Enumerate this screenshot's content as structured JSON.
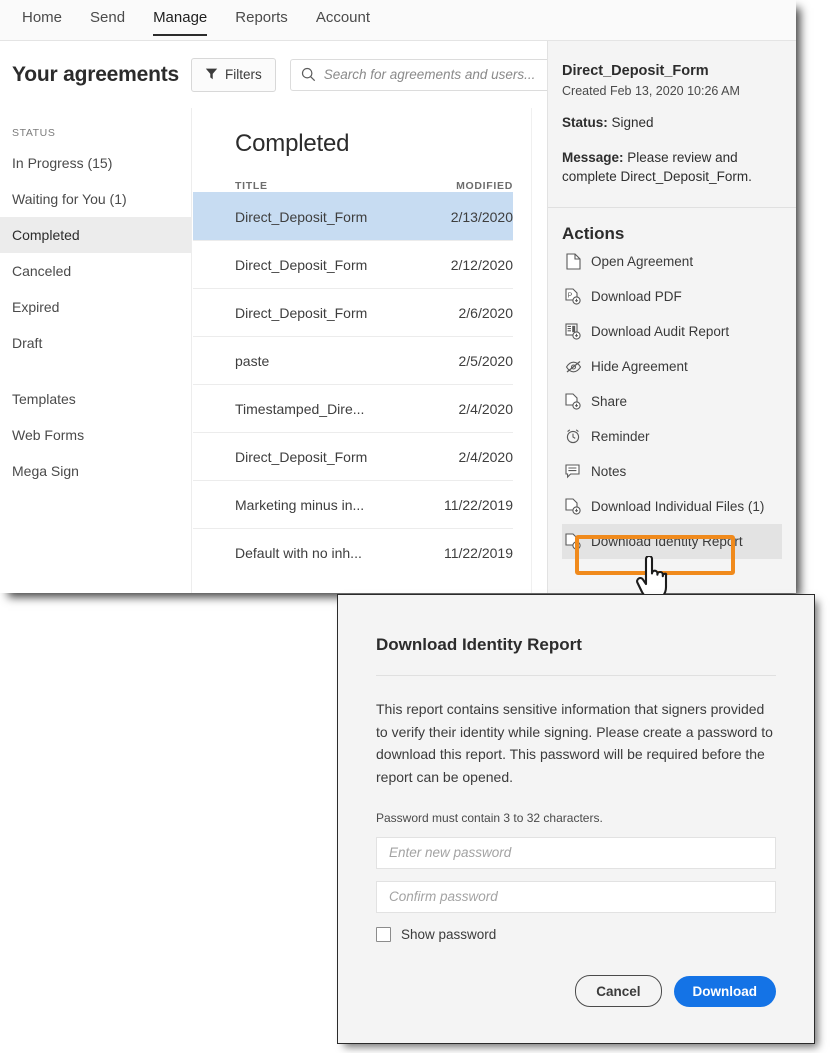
{
  "colors": {
    "accent_blue": "#1473E6",
    "callout_orange": "#F08A1C",
    "selected_row_blue": "#C7DCF2",
    "panel_gray": "#F4F4F4"
  },
  "top_nav": {
    "tabs": [
      {
        "label": "Home",
        "active": false
      },
      {
        "label": "Send",
        "active": false
      },
      {
        "label": "Manage",
        "active": true
      },
      {
        "label": "Reports",
        "active": false
      },
      {
        "label": "Account",
        "active": false
      }
    ]
  },
  "header": {
    "title": "Your agreements",
    "filters_label": "Filters",
    "filter_icon": "funnel-icon",
    "search": {
      "icon": "search-icon",
      "placeholder": "Search for agreements and users...",
      "value": ""
    }
  },
  "sidebar": {
    "section_label": "STATUS",
    "items": [
      {
        "label": "In Progress (15)",
        "selected": false
      },
      {
        "label": "Waiting for You (1)",
        "selected": false
      },
      {
        "label": "Completed",
        "selected": true
      },
      {
        "label": "Canceled",
        "selected": false
      },
      {
        "label": "Expired",
        "selected": false
      },
      {
        "label": "Draft",
        "selected": false
      }
    ],
    "secondary_items": [
      {
        "label": "Templates"
      },
      {
        "label": "Web Forms"
      },
      {
        "label": "Mega Sign"
      }
    ]
  },
  "list": {
    "title": "Completed",
    "columns": {
      "title": "TITLE",
      "modified": "MODIFIED"
    },
    "rows": [
      {
        "title": "Direct_Deposit_Form",
        "modified": "2/13/2020",
        "selected": true
      },
      {
        "title": "Direct_Deposit_Form",
        "modified": "2/12/2020",
        "selected": false
      },
      {
        "title": "Direct_Deposit_Form",
        "modified": "2/6/2020",
        "selected": false
      },
      {
        "title": "paste",
        "modified": "2/5/2020",
        "selected": false
      },
      {
        "title": "Timestamped_Dire...",
        "modified": "2/4/2020",
        "selected": false
      },
      {
        "title": "Direct_Deposit_Form",
        "modified": "2/4/2020",
        "selected": false
      },
      {
        "title": "Marketing minus in...",
        "modified": "11/22/2019",
        "selected": false
      },
      {
        "title": "Default with no inh...",
        "modified": "11/22/2019",
        "selected": false
      }
    ]
  },
  "detail": {
    "doc_name": "Direct_Deposit_Form",
    "created": "Created Feb 13, 2020 10:26 AM",
    "status_label": "Status:",
    "status_value": "Signed",
    "message_label": "Message:",
    "message_value": "Please review and complete Direct_Deposit_Form.",
    "actions_title": "Actions",
    "actions": [
      {
        "label": "Open Agreement",
        "icon": "document-icon",
        "hovered": false
      },
      {
        "label": "Download PDF",
        "icon": "pdf-download-icon",
        "hovered": false
      },
      {
        "label": "Download Audit Report",
        "icon": "audit-download-icon",
        "hovered": false
      },
      {
        "label": "Hide Agreement",
        "icon": "eye-off-icon",
        "hovered": false
      },
      {
        "label": "Share",
        "icon": "share-document-icon",
        "hovered": false
      },
      {
        "label": "Reminder",
        "icon": "alarm-clock-icon",
        "hovered": false
      },
      {
        "label": "Notes",
        "icon": "note-icon",
        "hovered": false
      },
      {
        "label": "Download Individual Files (1)",
        "icon": "file-download-icon",
        "hovered": false
      },
      {
        "label": "Download Identity Report",
        "icon": "file-download-icon",
        "hovered": true
      }
    ]
  },
  "modal": {
    "title": "Download Identity Report",
    "body": "This report contains sensitive information that signers provided to verify their identity while signing. Please create a password to download this report. This password will be required before the report can be opened.",
    "hint": "Password must contain 3 to 32 characters.",
    "password_placeholder": "Enter new password",
    "password_value": "",
    "confirm_placeholder": "Confirm password",
    "confirm_value": "",
    "show_password_label": "Show password",
    "show_password_checked": false,
    "cancel_label": "Cancel",
    "download_label": "Download"
  }
}
